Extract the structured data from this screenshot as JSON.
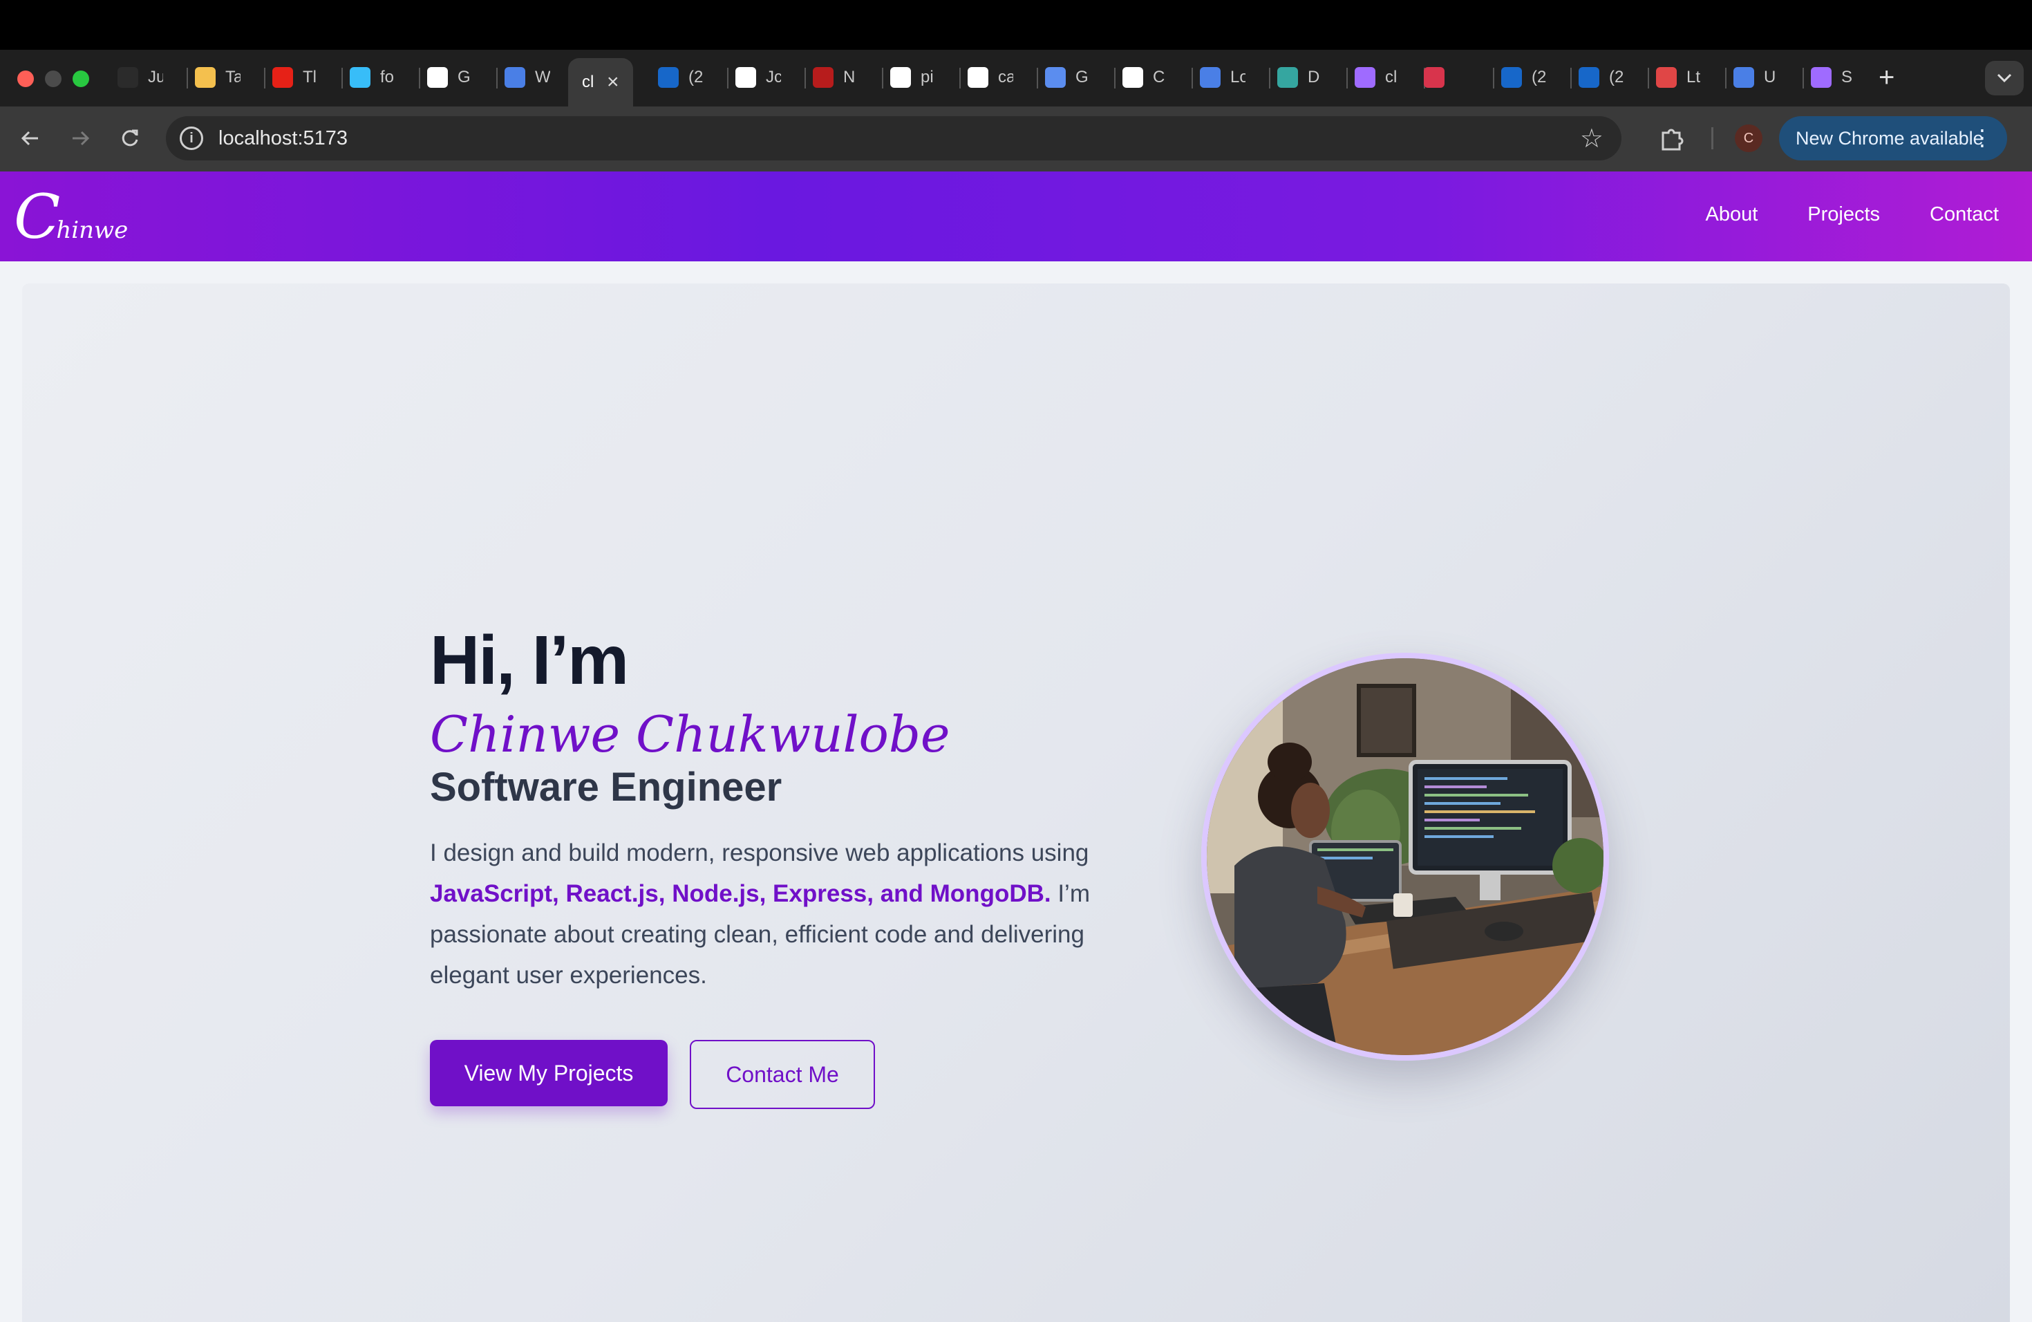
{
  "browser": {
    "tabs": [
      {
        "icon": "openai-icon",
        "title": "Ju",
        "color": "#2b2b2b"
      },
      {
        "icon": "emoji-icon",
        "title": "Ta",
        "color": "#f4c04e"
      },
      {
        "icon": "youtube-icon",
        "title": "Tl",
        "color": "#e62117"
      },
      {
        "icon": "tailwind-icon",
        "title": "fo",
        "color": "#38bdf8"
      },
      {
        "icon": "google-icon",
        "title": "G",
        "color": "#ffffff"
      },
      {
        "icon": "docs-icon",
        "title": "W",
        "color": "#4a7fe6"
      },
      {
        "icon": "linkedin-icon",
        "title": "(2",
        "color": "#1767c9"
      },
      {
        "icon": "openai-icon",
        "title": "Jc",
        "color": "#ffffff"
      },
      {
        "icon": "flag-icon",
        "title": "N",
        "color": "#b71c1c"
      },
      {
        "icon": "google-icon",
        "title": "pi",
        "color": "#ffffff"
      },
      {
        "icon": "google-icon",
        "title": "ca",
        "color": "#ffffff"
      },
      {
        "icon": "gemini-icon",
        "title": "G",
        "color": "#5b8def"
      },
      {
        "icon": "github-icon",
        "title": "C",
        "color": "#ffffff"
      },
      {
        "icon": "docs-icon",
        "title": "Lo",
        "color": "#4a7fe6"
      },
      {
        "icon": "diamond-icon",
        "title": "D",
        "color": "#35a6a0"
      },
      {
        "icon": "vite-icon",
        "title": "cl",
        "color": "#9f6bff"
      },
      {
        "icon": "puzzle-icon",
        "title": "",
        "color": "#d8344c"
      },
      {
        "icon": "linkedin-icon",
        "title": "(2",
        "color": "#1767c9"
      },
      {
        "icon": "linkedin-icon",
        "title": "(2",
        "color": "#1767c9"
      },
      {
        "icon": "swirl-icon",
        "title": "Lt",
        "color": "#e04646"
      },
      {
        "icon": "docs-icon",
        "title": "U",
        "color": "#4a7fe6"
      },
      {
        "icon": "vite-icon",
        "title": "S",
        "color": "#9f6bff"
      }
    ],
    "active_tab": {
      "title": "cl",
      "close": "×"
    },
    "new_tab": "+",
    "url": "localhost:5173",
    "profile_initial": "C",
    "update_label": "New Chrome available"
  },
  "site": {
    "logo_initial": "C",
    "logo_rest": "hinwe",
    "nav": [
      "About",
      "Projects",
      "Contact"
    ]
  },
  "hero": {
    "greeting": "Hi, I’m",
    "name": "Chinwe Chukwulobe",
    "role": "Software Engineer",
    "bio_before": "I design and build modern, responsive web applications using ",
    "bio_tech": "JavaScript, React.js, Node.js, Express, and MongoDB.",
    "bio_after": " I’m passionate about creating clean, efficient code and delivering elegant user experiences.",
    "primary_cta": "View My Projects",
    "secondary_cta": "Contact Me"
  }
}
